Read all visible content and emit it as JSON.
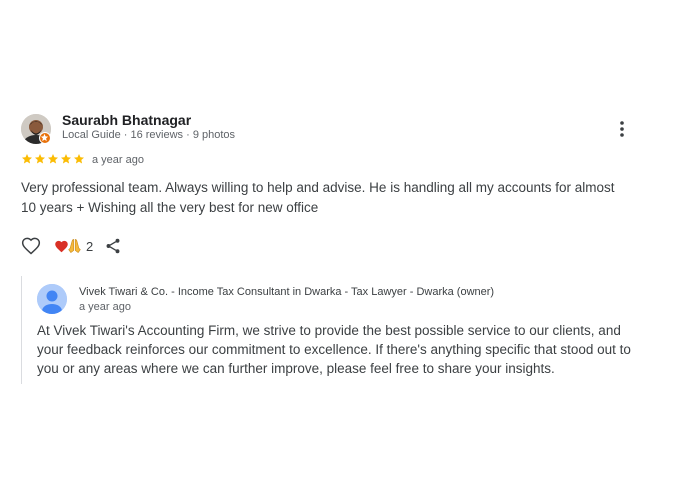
{
  "review": {
    "author": {
      "name": "Saurabh Bhatnagar",
      "meta": "Local Guide · 16 reviews · 9 photos"
    },
    "rating": 5,
    "time": "a year ago",
    "text": "Very professional team. Always willing to help and advise. He is handling all my accounts for almost 10 years + Wishing all the very best for new office",
    "reactions": {
      "count": "2",
      "emoji": [
        "heart",
        "folded-hands"
      ]
    },
    "icons": {
      "more": "more-vert-icon",
      "like": "heart-outline-icon",
      "share": "share-icon"
    }
  },
  "owner_reply": {
    "name": "Vivek Tiwari & Co. - Income Tax Consultant in Dwarka - Tax Lawyer - Dwarka (owner)",
    "time": "a year ago",
    "text": "At Vivek Tiwari's Accounting Firm, we strive to provide the best possible service to our clients, and your feedback reinforces our commitment to excellence. If there's anything specific that stood out to you or any areas where we can further improve, please feel free to share your insights."
  },
  "colors": {
    "star": "#fbbc04",
    "text": "#3c4043",
    "meta": "#5f6368",
    "badge": "#e8710a",
    "owner_avatar": "#aecbfa"
  }
}
